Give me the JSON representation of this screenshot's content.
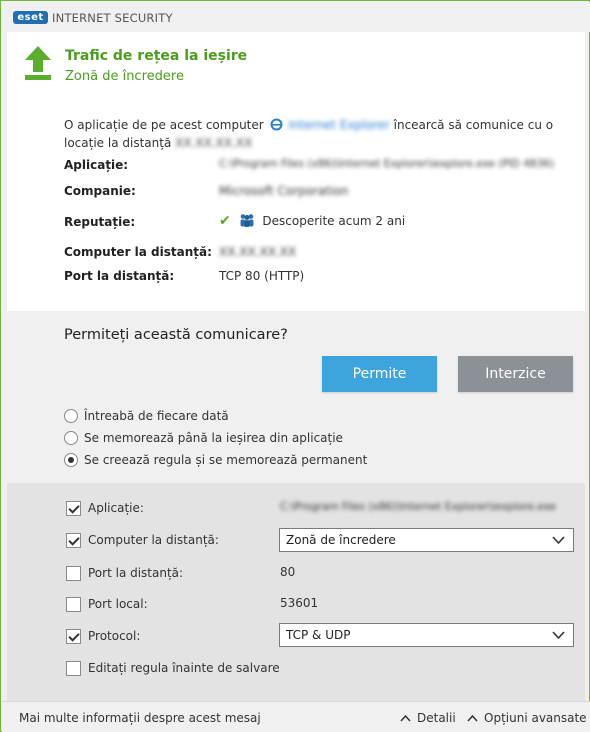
{
  "window": {
    "logo_text": "eset",
    "app_title": "INTERNET SECURITY"
  },
  "header": {
    "title": "Trafic de rețea la ieșire",
    "subtitle": "Zonă de încredere",
    "icon": "upload-arrow-icon"
  },
  "details": {
    "desc_prefix": "O aplicație de pe acest computer",
    "desc_app": "Internet Explorer",
    "desc_middle": "încearcă să comunice cu o locație la distanță",
    "desc_ip": "XX.XX.XX.XX",
    "rows": {
      "application_label": "Aplicație:",
      "application_value": "C:\\Program Files (x86)\\Internet Explorer\\iexplore.exe (PID 4836)",
      "company_label": "Companie:",
      "company_value": "Microsoft Corporation",
      "reputation_label": "Reputație:",
      "reputation_value": "Descoperite acum 2 ani",
      "remote_computer_label": "Computer la distanță:",
      "remote_computer_value": "XX.XX.XX.XX",
      "remote_port_label": "Port la distanță:",
      "remote_port_value": "TCP 80 (HTTP)"
    }
  },
  "question": {
    "title": "Permiteți această comunicare?",
    "allow_label": "Permite",
    "deny_label": "Interzice",
    "options": [
      "Întreabă de fiecare dată",
      "Se memorează până la ieșirea din aplicație",
      "Se creează regula și se memorează permanent"
    ],
    "selected_index": 2
  },
  "rules": {
    "application_label": "Aplicație:",
    "application_value": "C:\\Program Files (x86)\\Internet Explorer\\iexplore.exe",
    "remote_computer_label": "Computer la distanță:",
    "remote_computer_select": "Zonă de încredere",
    "remote_port_label": "Port la distanță:",
    "remote_port_value": "80",
    "local_port_label": "Port local:",
    "local_port_value": "53601",
    "protocol_label": "Protocol:",
    "protocol_select": "TCP & UDP",
    "edit_rule_label": "Editați regula înainte de salvare",
    "checked": {
      "application": true,
      "remote_computer": true,
      "remote_port": false,
      "local_port": false,
      "protocol": true,
      "edit_rule": false
    }
  },
  "footer": {
    "info_link": "Mai multe informații despre acest mesaj",
    "details_label": "Detalii",
    "advanced_label": "Opțiuni avansate"
  },
  "colors": {
    "accent_green": "#4a9e1c",
    "allow_blue": "#3ea4dd",
    "deny_grey": "#8b9196",
    "frame_green": "#6fb53c"
  }
}
